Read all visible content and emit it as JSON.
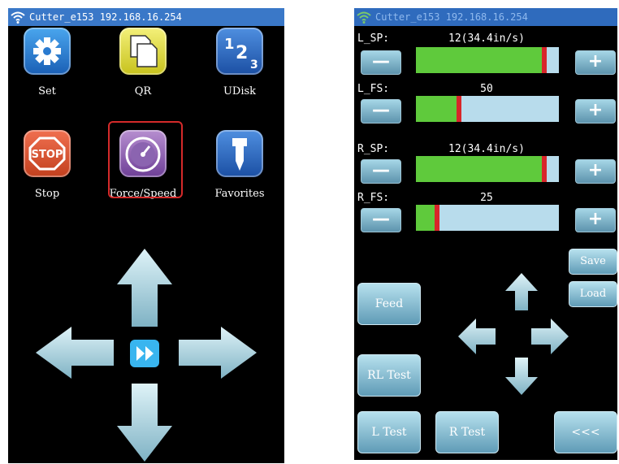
{
  "left_screen": {
    "status_text": "Cutter_e153 192.168.16.254",
    "apps": [
      {
        "label": "Set",
        "icon": "gear-icon"
      },
      {
        "label": "QR",
        "icon": "copy-icon"
      },
      {
        "label": "UDisk",
        "icon": "numbers-icon"
      },
      {
        "label": "Stop",
        "icon": "stop-sign-icon"
      },
      {
        "label": "Force/Speed",
        "icon": "gauge-icon"
      },
      {
        "label": "Favorites",
        "icon": "knife-tool-icon"
      }
    ],
    "selected_app": "Force/Speed",
    "arrows": [
      "arrow-up-icon",
      "arrow-left-icon",
      "arrow-right-icon",
      "arrow-down-icon",
      "fast-forward-icon"
    ]
  },
  "right_screen": {
    "status_text": "Cutter_e153 192.168.16.254",
    "rows": [
      {
        "label": "L_SP:",
        "value": "12(34.4in/s)",
        "fill": 0.9
      },
      {
        "label": "L_FS:",
        "value": "50",
        "fill": 0.3
      },
      {
        "label": "R_SP:",
        "value": "12(34.4in/s)",
        "fill": 0.9
      },
      {
        "label": "R_FS:",
        "value": "25",
        "fill": 0.15
      }
    ],
    "minus_symbol": "—",
    "plus_symbol": "+",
    "buttons": {
      "save": "Save",
      "load": "Load",
      "feed": "Feed",
      "rl_test": "RL Test",
      "l_test": "L Test",
      "r_test": "R Test",
      "back": "<<<"
    },
    "colors": {
      "fill": "#5fca3c",
      "marker": "#d8262a",
      "track": "#b8dcec"
    }
  }
}
